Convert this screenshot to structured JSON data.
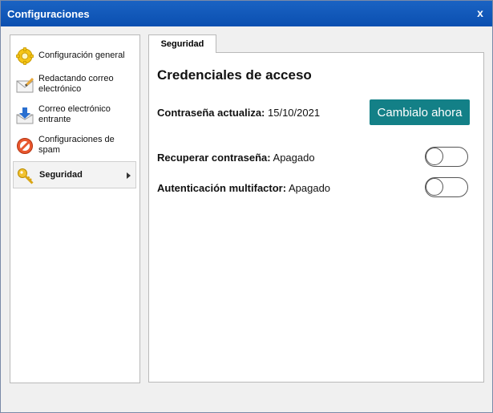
{
  "window": {
    "title": "Configuraciones",
    "close_label": "x"
  },
  "sidebar": {
    "items": [
      {
        "label": "Configuración general",
        "icon": "gear-icon"
      },
      {
        "label": "Redactando correo electrónico",
        "icon": "envelope-pencil-icon"
      },
      {
        "label": "Correo electrónico entrante",
        "icon": "inbox-download-icon"
      },
      {
        "label": "Configuraciones de spam",
        "icon": "no-entry-icon"
      },
      {
        "label": "Seguridad",
        "icon": "key-icon",
        "active": true
      }
    ]
  },
  "tabs": [
    {
      "label": "Seguridad"
    }
  ],
  "security": {
    "heading": "Credenciales de acceso",
    "password_label": "Contraseña actualiza:",
    "password_value": "15/10/2021",
    "change_button": "Cambialo ahora",
    "recover_label": "Recuperar contraseña:",
    "recover_value": "Apagado",
    "mfa_label": "Autenticación multifactor:",
    "mfa_value": "Apagado"
  },
  "colors": {
    "titlebar": "#0b4fb0",
    "accent_button": "#138087"
  }
}
